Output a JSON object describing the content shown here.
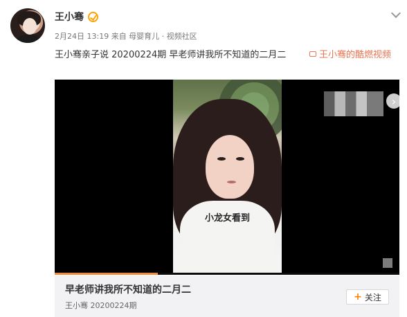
{
  "post": {
    "username": "王小骞",
    "meta": "2月24日 13:19 来自 母婴育儿 · 视频社区",
    "content": "王小骞亲子说 20200224期 早老师讲我所不知道的二月二",
    "video_link": "王小骞的酷燃视频"
  },
  "video": {
    "subtitle": "小龙女看到",
    "progress": 0.3
  },
  "card": {
    "title": "早老师讲我所不知道的二月二",
    "subtitle": "王小骞 20200224期",
    "follow_label": "关注"
  },
  "icons": {
    "verify": "verify-icon",
    "chevron": "chevron-down-icon",
    "video": "video-icon",
    "plus": "plus-icon",
    "fullscreen": "fullscreen-icon",
    "arrow": "arrow-right-icon"
  },
  "colors": {
    "accent": "#eb7350",
    "verify": "#ffa200",
    "follow_plus": "#ff7f00",
    "progress": "#f08a3a"
  }
}
